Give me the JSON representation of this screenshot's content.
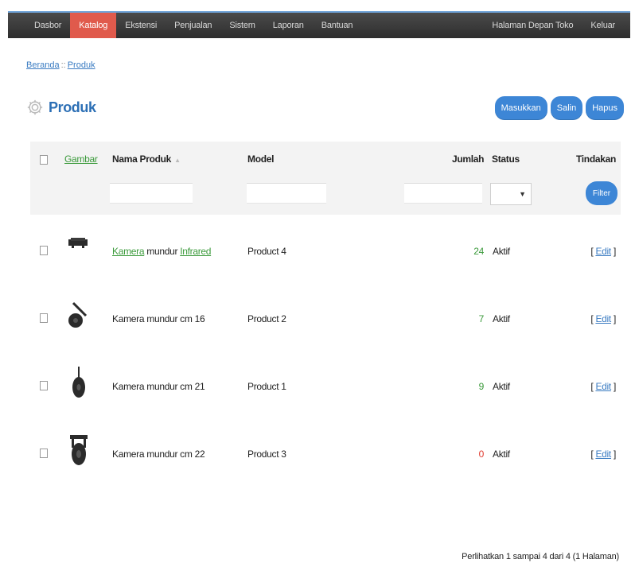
{
  "nav": {
    "left": [
      "Dasbor",
      "Katalog",
      "Ekstensi",
      "Penjualan",
      "Sistem",
      "Laporan",
      "Bantuan"
    ],
    "active": "Katalog",
    "right": [
      "Halaman Depan Toko",
      "Keluar"
    ]
  },
  "breadcrumb": {
    "home": "Beranda",
    "separator": "::",
    "current": "Produk"
  },
  "page_title": "Produk",
  "buttons": {
    "insert": "Masukkan",
    "copy": "Salin",
    "delete": "Hapus"
  },
  "table": {
    "headers": {
      "image": "Gambar",
      "name": "Nama Produk",
      "model": "Model",
      "quantity": "Jumlah",
      "status": "Status",
      "action": "Tindakan"
    },
    "filter_button": "Filter",
    "rows": [
      {
        "name_part1": "Kamera",
        "name_part2": " mundur ",
        "name_part3": "Infrared",
        "model": "Product 4",
        "quantity": "24",
        "status": "Aktif",
        "edit": "Edit",
        "qty_color": "#3b9a3b"
      },
      {
        "name": "Kamera mundur cm 16",
        "model": "Product 2",
        "quantity": "7",
        "status": "Aktif",
        "edit": "Edit",
        "qty_color": "#3b9a3b"
      },
      {
        "name": "Kamera mundur cm 21",
        "model": "Product 1",
        "quantity": "9",
        "status": "Aktif",
        "edit": "Edit",
        "qty_color": "#3b9a3b"
      },
      {
        "name": "Kamera mundur cm 22",
        "model": "Product 3",
        "quantity": "0",
        "status": "Aktif",
        "edit": "Edit",
        "qty_color": "#e03a2e"
      }
    ]
  },
  "pagination_text": "Perlihatkan 1 sampai 4 dari 4 (1 Halaman)",
  "colors": {
    "accent": "#3d86d6",
    "active_nav": "#e05a4c",
    "link_green": "#3b9a3b"
  }
}
